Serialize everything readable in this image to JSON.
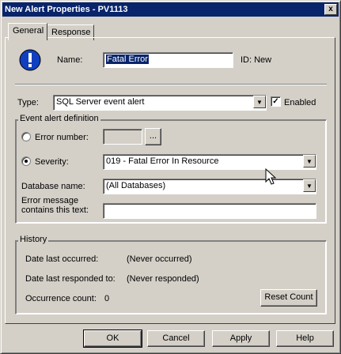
{
  "window": {
    "title": "New Alert Properties - PV1113",
    "close_glyph": "x"
  },
  "tabs": [
    {
      "label": "General",
      "active": true
    },
    {
      "label": "Response",
      "active": false
    }
  ],
  "general": {
    "name_label": "Name:",
    "name_value": "Fatal Error",
    "id_text": "ID: New",
    "type_label": "Type:",
    "type_value": "SQL Server event alert",
    "enabled_label": "Enabled",
    "enabled_checked": true,
    "event_group_label": "Event alert definition",
    "error_number_label": "Error number:",
    "error_number_value": "",
    "error_number_browse": "...",
    "severity_label": "Severity:",
    "severity_value": "019 - Fatal Error In Resource",
    "database_label": "Database name:",
    "database_value": "(All Databases)",
    "error_message_label_1": "Error message",
    "error_message_label_2": "contains this text:",
    "error_message_value": ""
  },
  "history": {
    "group_label": "History",
    "last_occurred_label": "Date last occurred:",
    "last_occurred_value": "(Never occurred)",
    "last_responded_label": "Date last responded to:",
    "last_responded_value": "(Never responded)",
    "occurrence_label": "Occurrence count:",
    "occurrence_value": "0",
    "reset_button": "Reset Count"
  },
  "buttons": {
    "ok": "OK",
    "cancel": "Cancel",
    "apply": "Apply",
    "help": "Help"
  },
  "icons": {
    "alert": "info-exclamation-icon",
    "dropdown": "chevron-down-icon",
    "cursor": "mouse-cursor-icon"
  },
  "colors": {
    "title_bar": "#08246b",
    "face": "#d4d0c8",
    "icon_blue": "#1040c0"
  }
}
